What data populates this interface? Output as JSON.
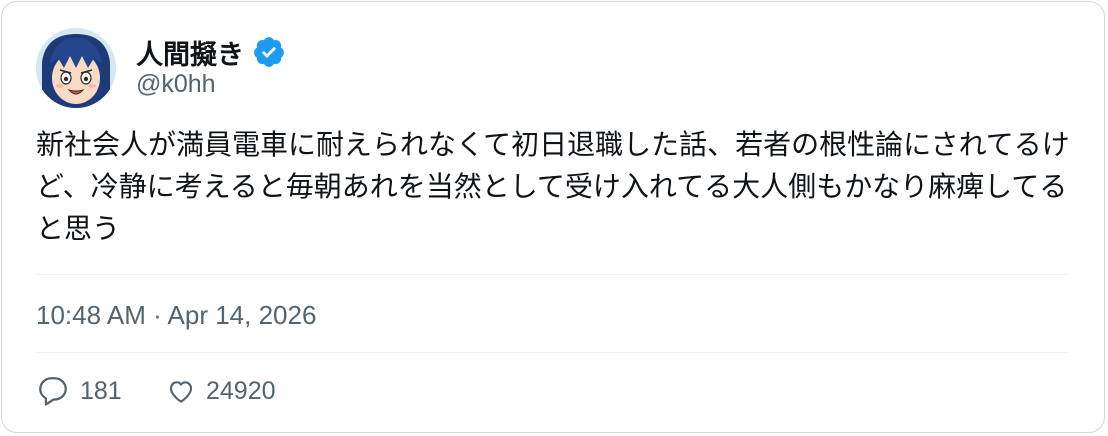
{
  "user": {
    "display_name": "人間擬き",
    "handle": "@k0hh",
    "verified": true,
    "avatar_icon": "anime-avatar-icon",
    "verified_icon": "verified-badge-icon"
  },
  "tweet": {
    "text": "新社会人が満員電車に耐えられなくて初日退職した話、若者の根性論にされてるけど、冷静に考えると毎朝あれを当然として受け入れてる大人側もかなり麻痺してると思う",
    "timestamp": "10:48 AM · Apr 14, 2026"
  },
  "actions": {
    "reply": {
      "icon": "reply-icon",
      "count": "181"
    },
    "like": {
      "icon": "heart-icon",
      "count": "24920"
    }
  },
  "colors": {
    "text_primary": "#0f1419",
    "text_secondary": "#536471",
    "border": "#cfd9de",
    "divider": "#eff3f4",
    "verified_blue": "#1d9bf0"
  }
}
